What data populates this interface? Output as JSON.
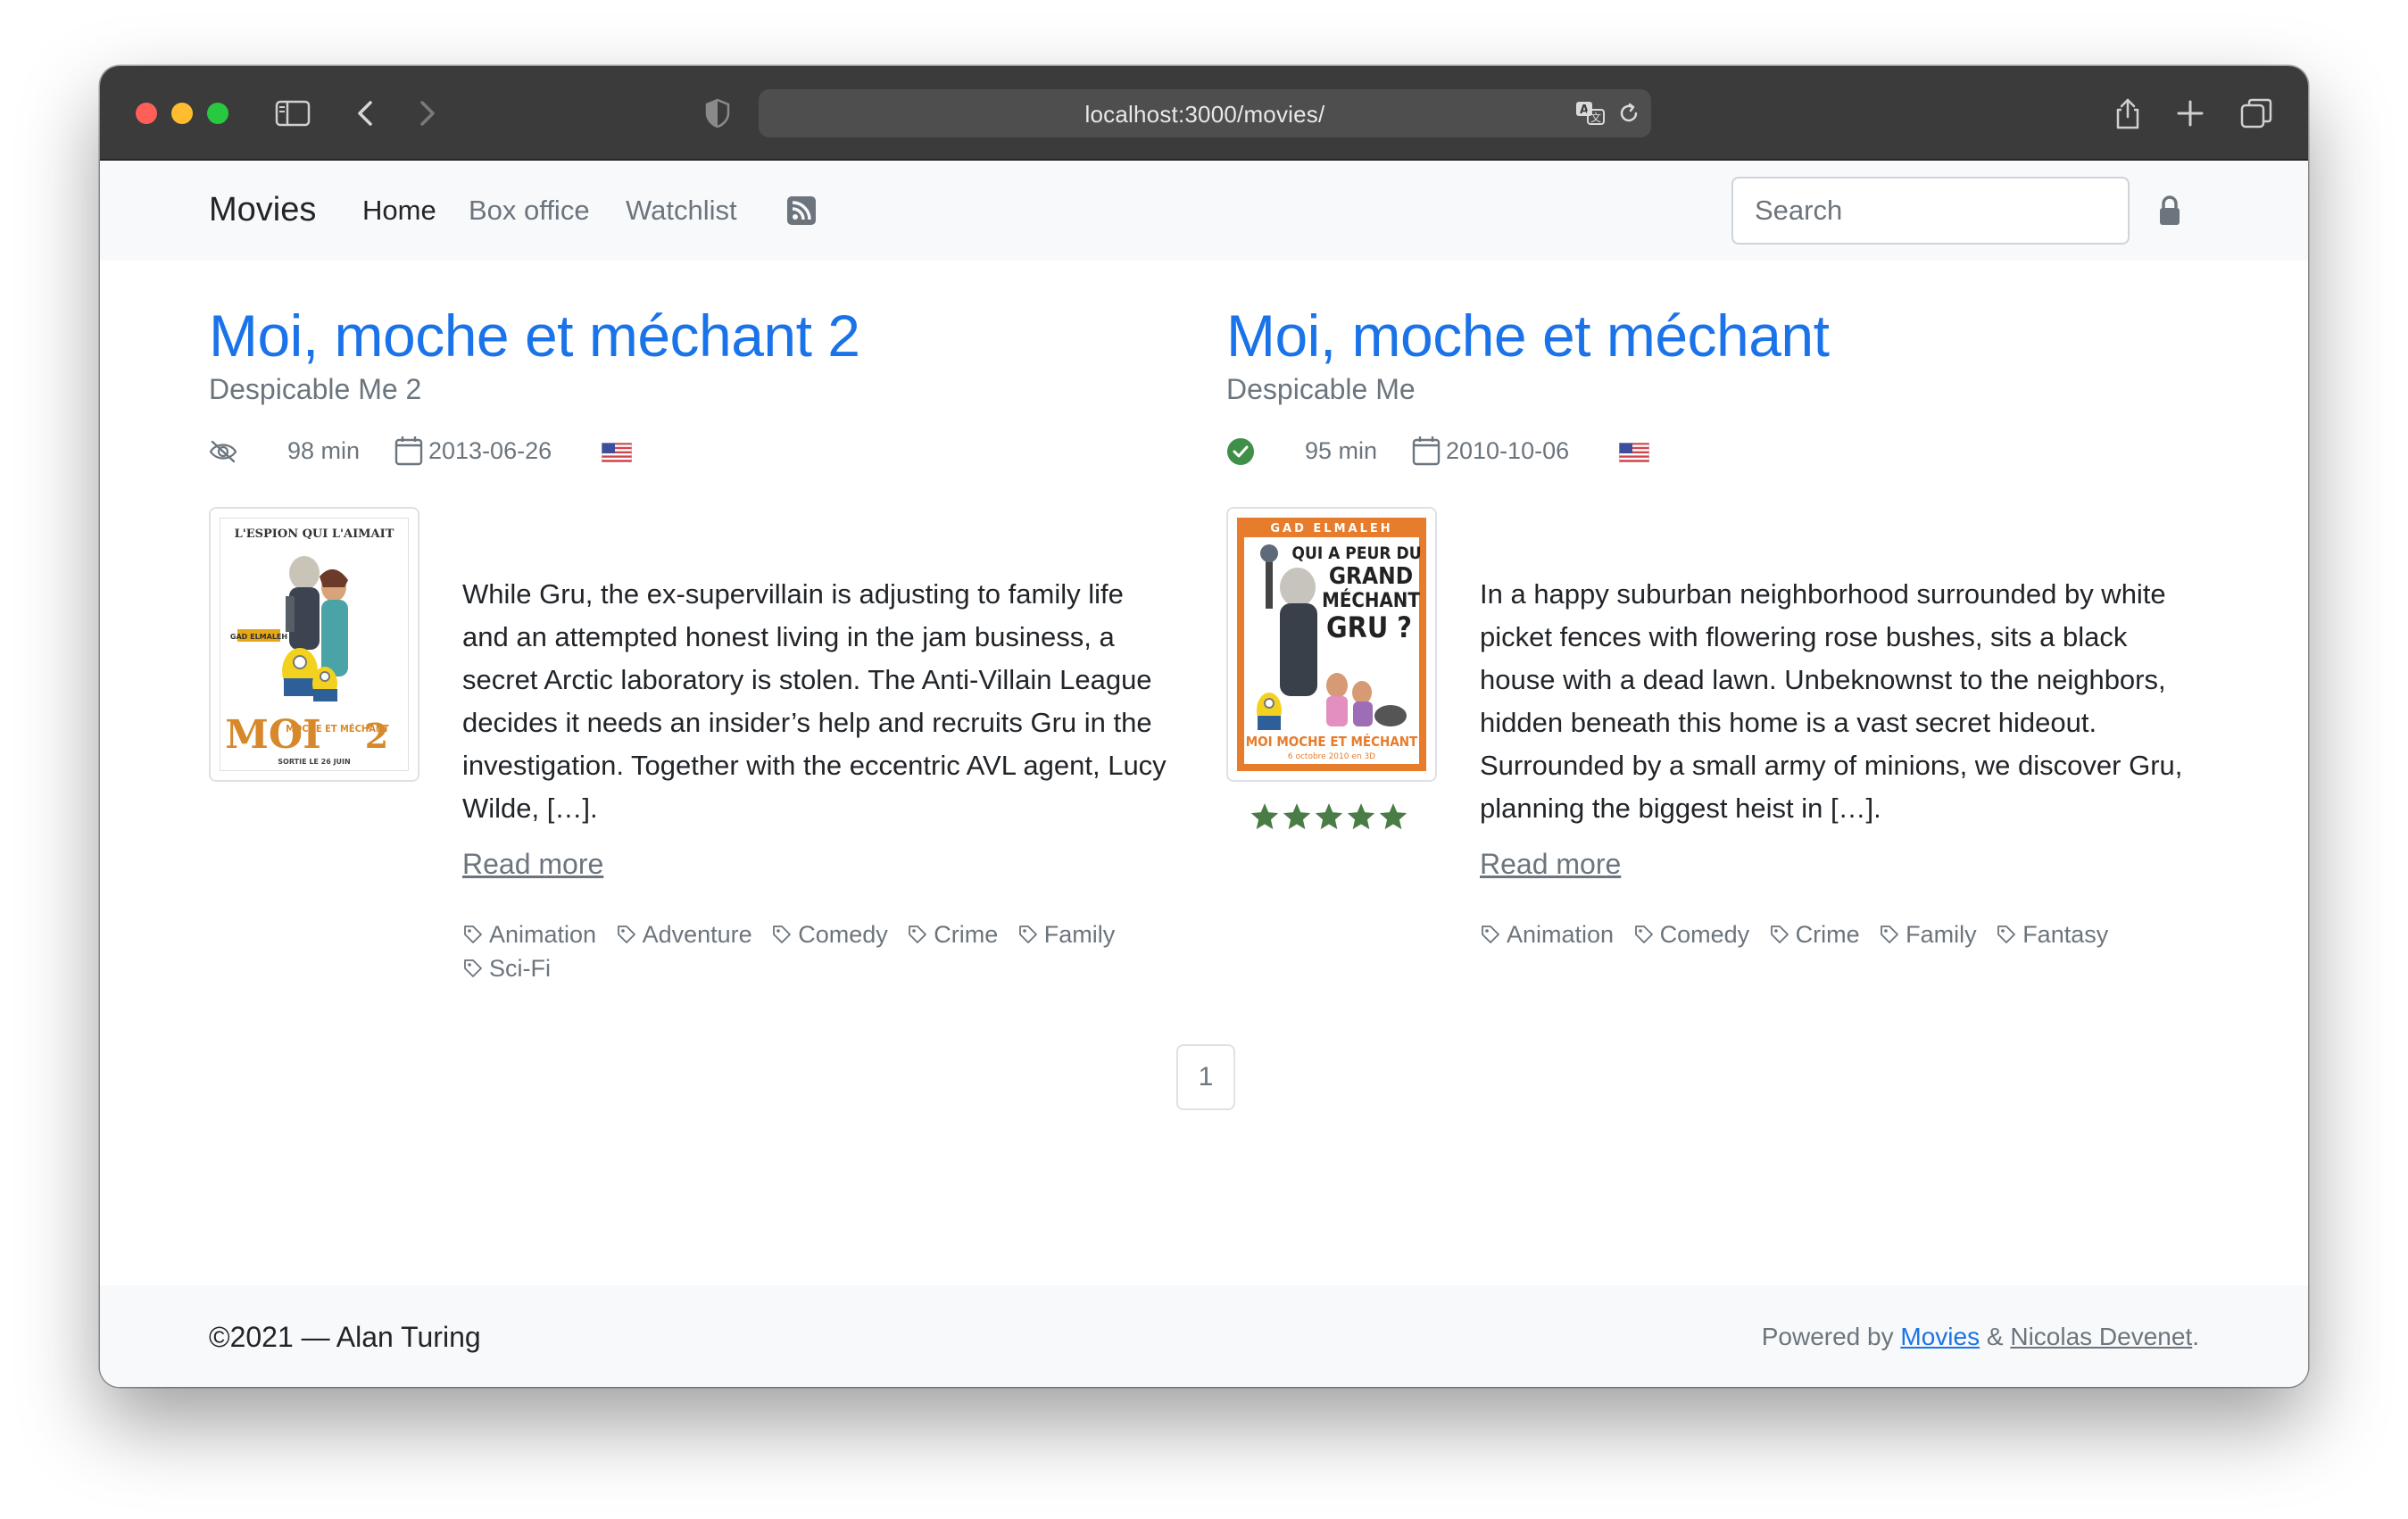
{
  "browser": {
    "url": "localhost:3000/movies/"
  },
  "nav": {
    "brand": "Movies",
    "links": [
      "Home",
      "Box office",
      "Watchlist"
    ],
    "search_placeholder": "Search"
  },
  "movies": [
    {
      "title": "Moi, moche et méchant 2",
      "original_title": "Despicable Me 2",
      "runtime": "98 min",
      "date": "2013-06-26",
      "watched": false,
      "overview": "While Gru, the ex-supervillain is adjusting to family life and an attempted honest living in the jam business, a secret Arctic laboratory is stolen. The Anti-Villain League decides it needs an insider’s help and recruits Gru in the investigation. Together with the eccentric AVL agent, Lucy Wilde, […].",
      "read_more": "Read more",
      "tags": [
        "Animation",
        "Adventure",
        "Comedy",
        "Crime",
        "Family",
        "Sci-Fi"
      ],
      "poster": {
        "top": "L'ESPION QUI L'AIMAIT",
        "moi": "MOI",
        "rest": "MOCHE ET MÉCHANT",
        "num": "2",
        "bottom": "SORTIE LE 26 JUIN"
      }
    },
    {
      "title": "Moi, moche et méchant",
      "original_title": "Despicable Me",
      "runtime": "95 min",
      "date": "2010-10-06",
      "watched": true,
      "rating": 5,
      "overview": "In a happy suburban neighborhood surrounded by white picket fences with flowering rose bushes, sits a black house with a dead lawn. Unbeknownst to the neighbors, hidden beneath this home is a vast secret hideout. Surrounded by a small army of minions, we discover Gru, planning the biggest heist in […].",
      "read_more": "Read more",
      "tags": [
        "Animation",
        "Comedy",
        "Crime",
        "Family",
        "Fantasy"
      ],
      "poster": {
        "top": "GAD ELMALEH",
        "line1": "QUI A PEUR DU",
        "line2": "GRAND",
        "line3": "MÉCHANT",
        "line4": "GRU ?",
        "bottom": "MOI MOCHE ET MÉCHANT",
        "date": "6 octobre 2010 en 3D"
      }
    }
  ],
  "pagination": {
    "current": "1"
  },
  "footer": {
    "copyright": "©2021 — Alan Turing",
    "powered_prefix": "Powered by",
    "link1": "Movies",
    "amp": "&",
    "link2": "Nicolas Devenet",
    "suffix": "."
  },
  "colors": {
    "link": "#1a73e8",
    "muted": "#6c757d",
    "watched_green": "#3f8f48",
    "star_green": "#4a7c46"
  }
}
